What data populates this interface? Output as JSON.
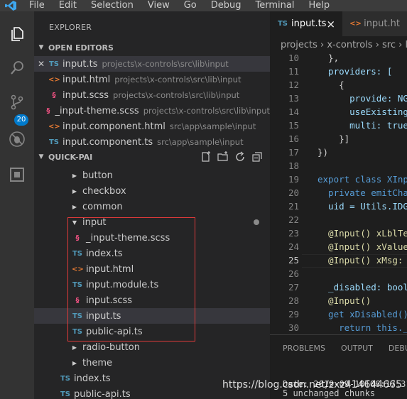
{
  "menu": [
    "File",
    "Edit",
    "Selection",
    "View",
    "Go",
    "Debug",
    "Terminal",
    "Help"
  ],
  "activity": {
    "scm_badge": "20"
  },
  "explorer": {
    "title": "EXPLORER",
    "open_editors_title": "OPEN EDITORS",
    "open_editors": [
      {
        "icon": "TS",
        "kind": "ts",
        "name": "input.ts",
        "path": "projects\\x-controls\\src\\lib\\input",
        "active": true
      },
      {
        "icon": "<>",
        "kind": "html",
        "name": "input.html",
        "path": "projects\\x-controls\\src\\lib\\input"
      },
      {
        "icon": "§",
        "kind": "scss",
        "name": "input.scss",
        "path": "projects\\x-controls\\src\\lib\\input"
      },
      {
        "icon": "§",
        "kind": "scss",
        "name": "_input-theme.scss",
        "path": "projects\\x-controls\\src\\lib\\input"
      },
      {
        "icon": "<>",
        "kind": "html",
        "name": "input.component.html",
        "path": "src\\app\\sample\\input"
      },
      {
        "icon": "TS",
        "kind": "ts",
        "name": "input.component.ts",
        "path": "src\\app\\sample\\input"
      }
    ],
    "workspace_title": "QUICK-PAI",
    "tree": [
      {
        "twisty": "▶",
        "name": "button"
      },
      {
        "twisty": "▶",
        "name": "checkbox"
      },
      {
        "twisty": "▶",
        "name": "common"
      },
      {
        "twisty": "▼",
        "name": "input"
      }
    ],
    "input_children": [
      {
        "icon": "§",
        "kind": "scss",
        "name": "_input-theme.scss"
      },
      {
        "icon": "TS",
        "kind": "ts",
        "name": "index.ts"
      },
      {
        "icon": "<>",
        "kind": "html",
        "name": "input.html"
      },
      {
        "icon": "TS",
        "kind": "ts",
        "name": "input.module.ts"
      },
      {
        "icon": "§",
        "kind": "scss",
        "name": "input.scss"
      },
      {
        "icon": "TS",
        "kind": "ts",
        "name": "input.ts"
      },
      {
        "icon": "TS",
        "kind": "ts",
        "name": "public-api.ts"
      }
    ],
    "tree_after": [
      {
        "twisty": "▶",
        "name": "radio-button"
      },
      {
        "twisty": "▶",
        "name": "theme"
      }
    ],
    "root_files": [
      {
        "icon": "TS",
        "kind": "ts",
        "name": "index.ts"
      },
      {
        "icon": "TS",
        "kind": "ts",
        "name": "public-api.ts"
      }
    ]
  },
  "editor": {
    "tabs": [
      {
        "icon": "TS",
        "label": "input.ts",
        "close": "×"
      },
      {
        "icon": "<>",
        "label": "input.ht"
      }
    ],
    "breadcrumb": "projects › x-controls › src › lib",
    "lines": [
      {
        "n": "10",
        "code": "  },",
        "cls": ""
      },
      {
        "n": "11",
        "code": "  providers: [",
        "cls": "prop"
      },
      {
        "n": "12",
        "code": "    {",
        "cls": ""
      },
      {
        "n": "13",
        "code": "      provide: NG",
        "cls": "prop"
      },
      {
        "n": "14",
        "code": "      useExisting",
        "cls": "prop"
      },
      {
        "n": "15",
        "code": "      multi: true",
        "cls": "prop"
      },
      {
        "n": "16",
        "code": "    }]",
        "cls": ""
      },
      {
        "n": "17",
        "code": "})",
        "cls": ""
      },
      {
        "n": "18",
        "code": "",
        "cls": ""
      },
      {
        "n": "19",
        "code": "export class XInp",
        "cls": "kw"
      },
      {
        "n": "20",
        "code": "  private emitCha",
        "cls": "kw"
      },
      {
        "n": "21",
        "code": "  uid = Utils.IDG",
        "cls": "prop"
      },
      {
        "n": "22",
        "code": "",
        "cls": ""
      },
      {
        "n": "23",
        "code": "  @Input() xLblTe",
        "cls": "dec"
      },
      {
        "n": "24",
        "code": "  @Input() xValue",
        "cls": "dec"
      },
      {
        "n": "25",
        "code": "  @Input() xMsg: ",
        "cls": "dec"
      },
      {
        "n": "26",
        "code": "",
        "cls": ""
      },
      {
        "n": "27",
        "code": "  _disabled: bool",
        "cls": "prop"
      },
      {
        "n": "28",
        "code": "  @Input()",
        "cls": "dec"
      },
      {
        "n": "29",
        "code": "  get xDisabled()",
        "cls": "kw"
      },
      {
        "n": "30",
        "code": "    return this._",
        "cls": "kw"
      }
    ],
    "panel_tabs": [
      "PROBLEMS",
      "OUTPUT",
      "DEBUG C"
    ],
    "terminal": [
      "Date: 2019-09-10T06:17:31",
      "5 unchanged chunks"
    ]
  },
  "watermark": "https://blog.csdn.net/zxz414644665"
}
